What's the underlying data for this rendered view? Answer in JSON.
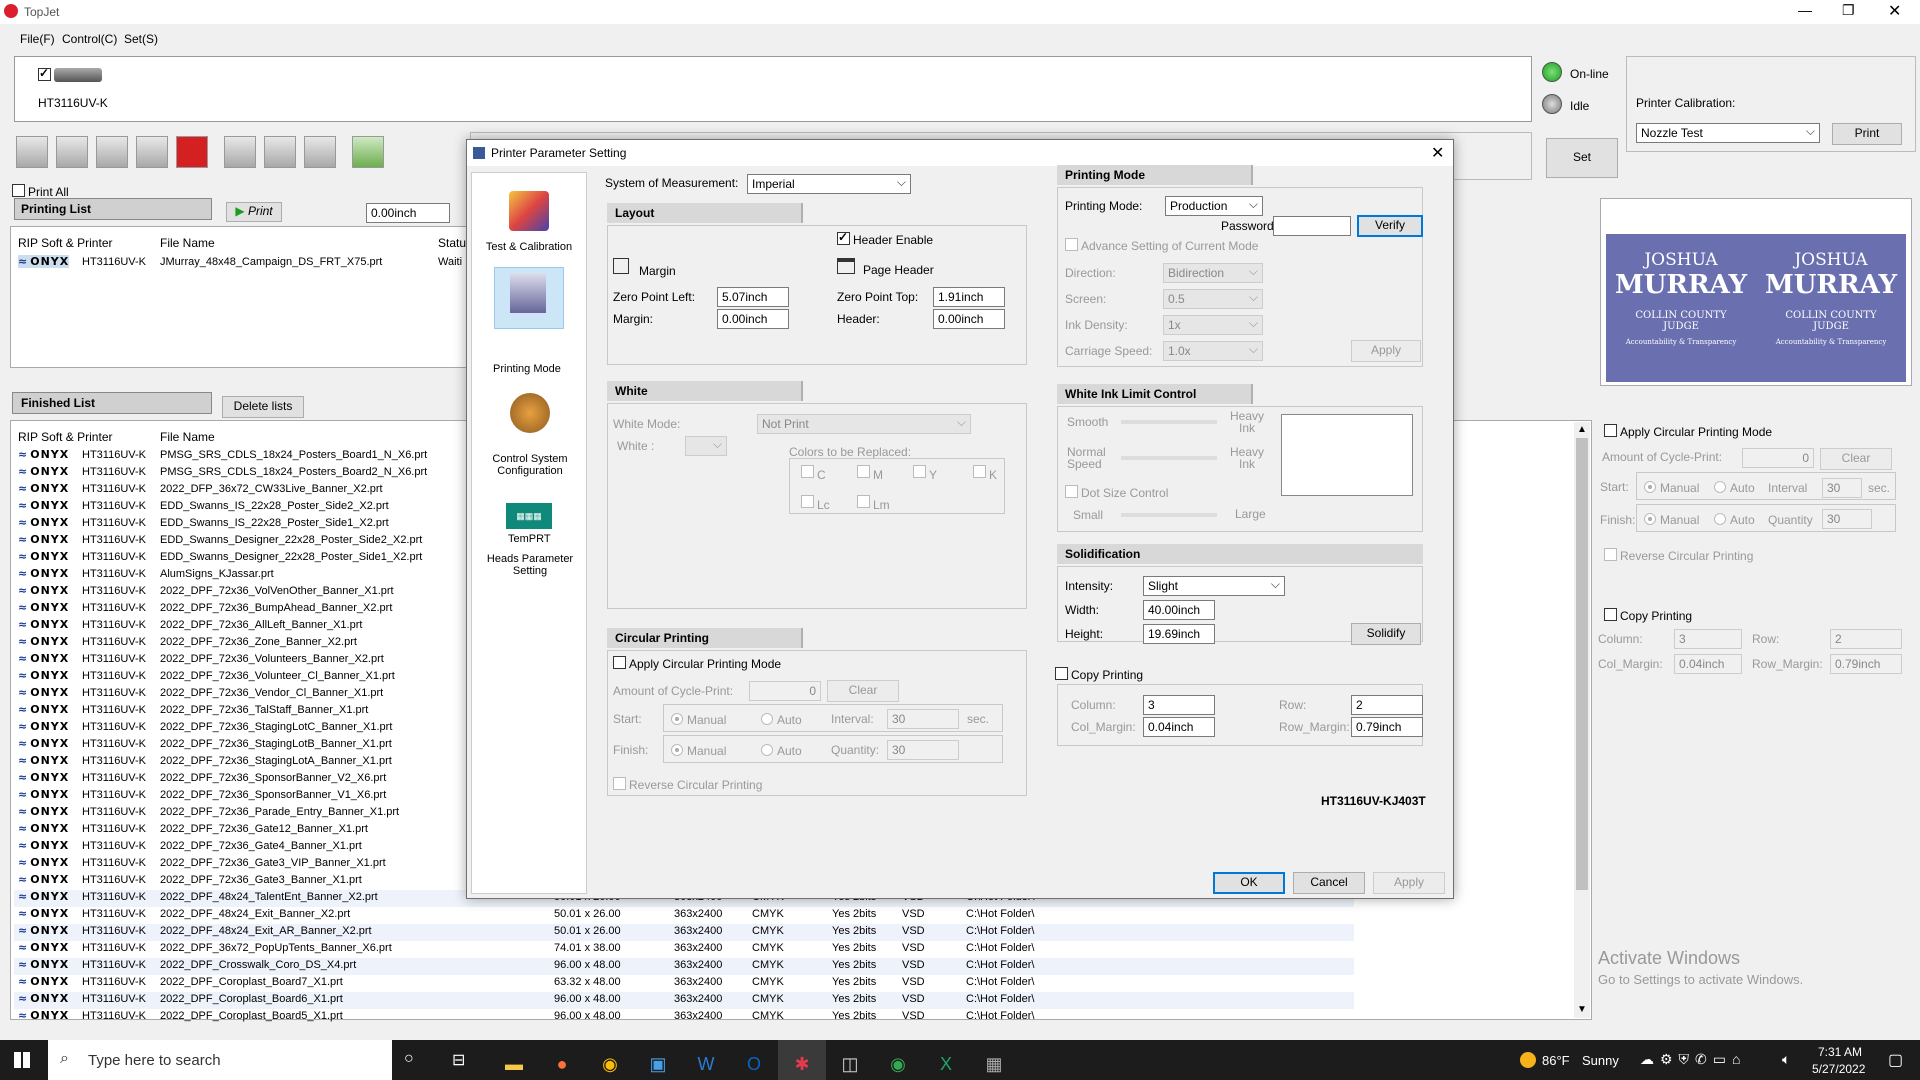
{
  "app": {
    "title": "TopJet",
    "menu": [
      "File(F)",
      "Control(C)",
      "Set(S)"
    ]
  },
  "printer": {
    "name": "HT3116UV-K",
    "status_online": "On-line",
    "status_idle": "Idle",
    "set_label": "Set",
    "calibration_label": "Printer Calibration:",
    "calibration_value": "Nozzle Test",
    "print_label": "Print"
  },
  "print_list": {
    "print_all": "Print All",
    "title": "Printing List",
    "print_btn": "Print",
    "offset": "0.00inch",
    "col_rip": "RIP Soft & Printer",
    "col_file": "File Name",
    "col_status": "Status",
    "job_printer": "HT3116UV-K",
    "job_file": "JMurray_48x48_Campaign_DS_FRT_X75.prt",
    "job_status": "Waiti"
  },
  "finished": {
    "title": "Finished List",
    "delete_btn": "Delete lists",
    "col_rip": "RIP Soft & Printer",
    "col_file": "File Name",
    "onyx": "ONYX",
    "printer": "HT3116UV-K",
    "files": [
      "PMSG_SRS_CDLS_18x24_Posters_Board1_N_X6.prt",
      "PMSG_SRS_CDLS_18x24_Posters_Board2_N_X6.prt",
      "2022_DFP_36x72_CW33Live_Banner_X2.prt",
      "EDD_Swanns_IS_22x28_Poster_Side2_X2.prt",
      "EDD_Swanns_IS_22x28_Poster_Side1_X2.prt",
      "EDD_Swanns_Designer_22x28_Poster_Side2_X2.prt",
      "EDD_Swanns_Designer_22x28_Poster_Side1_X2.prt",
      "AlumSigns_KJassar.prt",
      "2022_DPF_72x36_VolVenOther_Banner_X1.prt",
      "2022_DPF_72x36_BumpAhead_Banner_X2.prt",
      "2022_DPF_72x36_AllLeft_Banner_X1.prt",
      "2022_DPF_72x36_Zone_Banner_X2.prt",
      "2022_DPF_72x36_Volunteers_Banner_X2.prt",
      "2022_DPF_72x36_Volunteer_Cl_Banner_X1.prt",
      "2022_DPF_72x36_Vendor_Cl_Banner_X1.prt",
      "2022_DPF_72x36_TalStaff_Banner_X1.prt",
      "2022_DPF_72x36_StagingLotC_Banner_X1.prt",
      "2022_DPF_72x36_StagingLotB_Banner_X1.prt",
      "2022_DPF_72x36_StagingLotA_Banner_X1.prt",
      "2022_DPF_72x36_SponsorBanner_V2_X6.prt",
      "2022_DPF_72x36_SponsorBanner_V1_X6.prt",
      "2022_DPF_72x36_Parade_Entry_Banner_X1.prt",
      "2022_DPF_72x36_Gate12_Banner_X1.prt",
      "2022_DPF_72x36_Gate4_Banner_X1.prt",
      "2022_DPF_72x36_Gate3_VIP_Banner_X1.prt",
      "2022_DPF_72x36_Gate3_Banner_X1.prt",
      "2022_DPF_48x24_TalentEnt_Banner_X2.prt",
      "2022_DPF_48x24_Exit_Banner_X2.prt",
      "2022_DPF_48x24_Exit_AR_Banner_X2.prt",
      "2022_DPF_36x72_PopUpTents_Banner_X6.prt",
      "2022_DPF_Crosswalk_Coro_DS_X4.prt",
      "2022_DPF_Coroplast_Board7_X1.prt",
      "2022_DPF_Coroplast_Board6_X1.prt",
      "2022_DPF_Coroplast_Board5_X1.prt"
    ],
    "detail_rows": [
      {
        "size": "50.01 x 26.00",
        "res": "363x2400",
        "color": "CMYK",
        "bits": "Yes 2bits",
        "mode": "VSD",
        "folder": "C:\\Hot Folder\\"
      },
      {
        "size": "50.01 x 26.00",
        "res": "363x2400",
        "color": "CMYK",
        "bits": "Yes 2bits",
        "mode": "VSD",
        "folder": "C:\\Hot Folder\\"
      },
      {
        "size": "50.01 x 26.00",
        "res": "363x2400",
        "color": "CMYK",
        "bits": "Yes 2bits",
        "mode": "VSD",
        "folder": "C:\\Hot Folder\\"
      },
      {
        "size": "74.01 x 38.00",
        "res": "363x2400",
        "color": "CMYK",
        "bits": "Yes 2bits",
        "mode": "VSD",
        "folder": "C:\\Hot Folder\\"
      },
      {
        "size": "96.00 x 48.00",
        "res": "363x2400",
        "color": "CMYK",
        "bits": "Yes 2bits",
        "mode": "VSD",
        "folder": "C:\\Hot Folder\\"
      },
      {
        "size": "63.32 x 48.00",
        "res": "363x2400",
        "color": "CMYK",
        "bits": "Yes 2bits",
        "mode": "VSD",
        "folder": "C:\\Hot Folder\\"
      },
      {
        "size": "96.00 x 48.00",
        "res": "363x2400",
        "color": "CMYK",
        "bits": "Yes 2bits",
        "mode": "VSD",
        "folder": "C:\\Hot Folder\\"
      },
      {
        "size": "96.00 x 48.00",
        "res": "363x2400",
        "color": "CMYK",
        "bits": "Yes 2bits",
        "mode": "VSD",
        "folder": "C:\\Hot Folder\\"
      }
    ]
  },
  "right_panel": {
    "preview_line1": "JOSHUA",
    "preview_line2": "MURRAY",
    "preview_line3": "COLLIN COUNTY",
    "preview_line4": "JUDGE",
    "preview_line5": "Accountability & Transparency",
    "apply_circular": "Apply Circular Printing Mode",
    "amount": "Amount of Cycle-Print:",
    "amount_val": "0",
    "clear": "Clear",
    "start": "Start:",
    "finish": "Finish:",
    "manual": "Manual",
    "auto": "Auto",
    "interval": "Interval",
    "interval_val": "30",
    "sec": "sec.",
    "quantity": "Quantity",
    "quantity_val": "30",
    "reverse": "Reverse Circular Printing",
    "copy": "Copy Printing",
    "column": "Column:",
    "column_val": "3",
    "row": "Row:",
    "row_val": "2",
    "col_margin": "Col_Margin:",
    "col_margin_val": "0.04inch",
    "row_margin": "Row_Margin:",
    "row_margin_val": "0.79inch"
  },
  "watermark": {
    "line1": "Activate Windows",
    "line2": "Go to Settings to activate Windows."
  },
  "dialog": {
    "title": "Printer Parameter Setting",
    "nav": [
      "Test & Calibration",
      "Printing Mode",
      "Control System Configuration",
      "Heads Parameter Setting"
    ],
    "nav_tempr": "TemPRT",
    "measurement_label": "System of Measurement:",
    "measurement_value": "Imperial",
    "layout": {
      "title": "Layout",
      "header_enable": "Header Enable",
      "margin": "Margin",
      "page_header": "Page Header",
      "zero_left": "Zero Point Left:",
      "zero_left_val": "5.07inch",
      "zero_top": "Zero Point Top:",
      "zero_top_val": "1.91inch",
      "margin_lbl": "Margin:",
      "margin_val": "0.00inch",
      "header_lbl": "Header:",
      "header_val": "0.00inch"
    },
    "white": {
      "title": "White",
      "mode_lbl": "White Mode:",
      "mode_val": "Not Print",
      "white_lbl": "White :",
      "colors_lbl": "Colors to be Replaced:",
      "c": "C",
      "m": "M",
      "y": "Y",
      "k": "K",
      "lc": "Lc",
      "lm": "Lm"
    },
    "circular": {
      "title": "Circular Printing",
      "apply": "Apply Circular Printing Mode",
      "amount": "Amount of Cycle-Print:",
      "amount_val": "0",
      "clear": "Clear",
      "start": "Start:",
      "finish": "Finish:",
      "manual": "Manual",
      "auto": "Auto",
      "interval": "Interval:",
      "interval_val": "30",
      "sec": "sec.",
      "quantity": "Quantity:",
      "quantity_val": "30",
      "reverse": "Reverse Circular Printing"
    },
    "mode": {
      "title": "Printing Mode",
      "mode_lbl": "Printing Mode:",
      "mode_val": "Production",
      "password": "Password",
      "verify": "Verify",
      "advance": "Advance Setting of Current Mode",
      "direction": "Direction:",
      "direction_val": "Bidirection",
      "screen": "Screen:",
      "screen_val": "0.5",
      "ink": "Ink Density:",
      "ink_val": "1x",
      "carriage": "Carriage Speed:",
      "carriage_val": "1.0x",
      "apply": "Apply"
    },
    "whiteink": {
      "title": "White Ink Limit Control",
      "smooth": "Smooth",
      "heavy": "Heavy Ink",
      "normal": "Normal Speed",
      "heavy2": "Heavy Ink",
      "dot": "Dot Size Control",
      "small": "Small",
      "large": "Large"
    },
    "solid": {
      "title": "Solidification",
      "intensity": "Intensity:",
      "intensity_val": "Slight",
      "width": "Width:",
      "width_val": "40.00inch",
      "height": "Height:",
      "height_val": "19.69inch",
      "solidify": "Solidify"
    },
    "copy": {
      "title": "Copy Printing",
      "column": "Column:",
      "column_val": "3",
      "row": "Row:",
      "row_val": "2",
      "col_margin": "Col_Margin:",
      "col_margin_val": "0.04inch",
      "row_margin": "Row_Margin:",
      "row_margin_val": "0.79inch"
    },
    "model": "HT3116UV-KJ403T",
    "ok": "OK",
    "cancel": "Cancel",
    "apply": "Apply"
  },
  "taskbar": {
    "search": "Type here to search",
    "weather_temp": "86°F",
    "weather": "Sunny",
    "time": "7:31 AM",
    "date": "5/27/2022"
  }
}
